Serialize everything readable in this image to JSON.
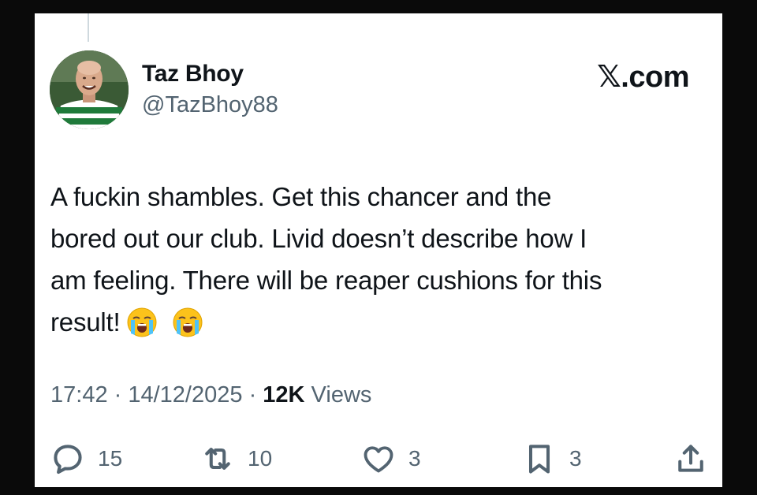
{
  "author": {
    "display_name": "Taz Bhoy",
    "handle": "@TazBhoy88"
  },
  "brand": {
    "prefix": "𝕏",
    "suffix": ".com"
  },
  "tweet": {
    "lines": [
      "A fuckin shambles. Get this chancer and the",
      "bored out our club. Livid doesn’t describe how I",
      "am feeling. There will be reaper cushions for this",
      "result!"
    ],
    "emojis": [
      "loudly-crying-face-emoji",
      "loudly-crying-face-emoji"
    ]
  },
  "meta": {
    "time": "17:42",
    "sep1": " · ",
    "date": "14/12/2025",
    "sep2": " · ",
    "views_count": "12K",
    "views_label": " Views"
  },
  "actions": {
    "replies": {
      "icon": "reply-icon",
      "count": "15"
    },
    "reposts": {
      "icon": "repost-icon",
      "count": "10"
    },
    "likes": {
      "icon": "like-icon",
      "count": "3"
    },
    "bookmarks": {
      "icon": "bookmark-icon",
      "count": "3"
    },
    "share": {
      "icon": "share-icon"
    }
  },
  "colors": {
    "text_primary": "#0f1419",
    "text_secondary": "#536471",
    "background": "#ffffff",
    "frame": "#0a0a0a"
  }
}
